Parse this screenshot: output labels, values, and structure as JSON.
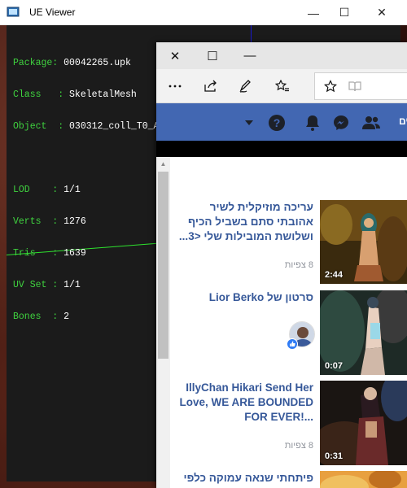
{
  "ue_viewer": {
    "title": "UE Viewer",
    "info": [
      {
        "key": "Package: ",
        "value": "00042265.upk"
      },
      {
        "key": "Class   : ",
        "value": "SkeletalMesh"
      },
      {
        "key": "Object  : ",
        "value": "030312_coll_T0_A"
      }
    ],
    "stats": [
      {
        "key": "LOD    : ",
        "value": "1/1"
      },
      {
        "key": "Verts  : ",
        "value": "1276"
      },
      {
        "key": "Tris   : ",
        "value": "1639"
      },
      {
        "key": "UV Set : ",
        "value": "1/1"
      },
      {
        "key": "Bones  : ",
        "value": "2"
      }
    ],
    "controls": {
      "minimize": "—",
      "maximize": "☐",
      "close": "✕"
    }
  },
  "browser": {
    "titlebar": {
      "close": "✕",
      "maximize": "☐",
      "minimize": "—"
    },
    "toolbar_icons": [
      "more-icon",
      "share-icon",
      "pen-icon",
      "favorites-list-icon",
      "star-icon",
      "reading-view-icon"
    ],
    "facebook": {
      "home_label": "ים",
      "icons": [
        "dropdown-arrow-icon",
        "help-icon",
        "notifications-icon",
        "messenger-icon",
        "friends-icon"
      ],
      "brand_color": "#4267b2"
    },
    "videos": [
      {
        "title": "עריכה מוזיקלית לשיר אהובתי סתם בשביל הכיף ושלושת המובילות שלי <3...",
        "views": "8 צפיות",
        "duration": "2:44"
      },
      {
        "title": "סרטון של Lior Berko",
        "views": "",
        "duration": "0:07"
      },
      {
        "title": "IllyChan Hikari Send Her Love, WE ARE BOUNDED FOR EVER!...",
        "views": "8 צפיות",
        "duration": "0:31"
      },
      {
        "title": "פיתחתי שנאה עמוקה כלפי",
        "views": "",
        "duration": ""
      }
    ]
  }
}
